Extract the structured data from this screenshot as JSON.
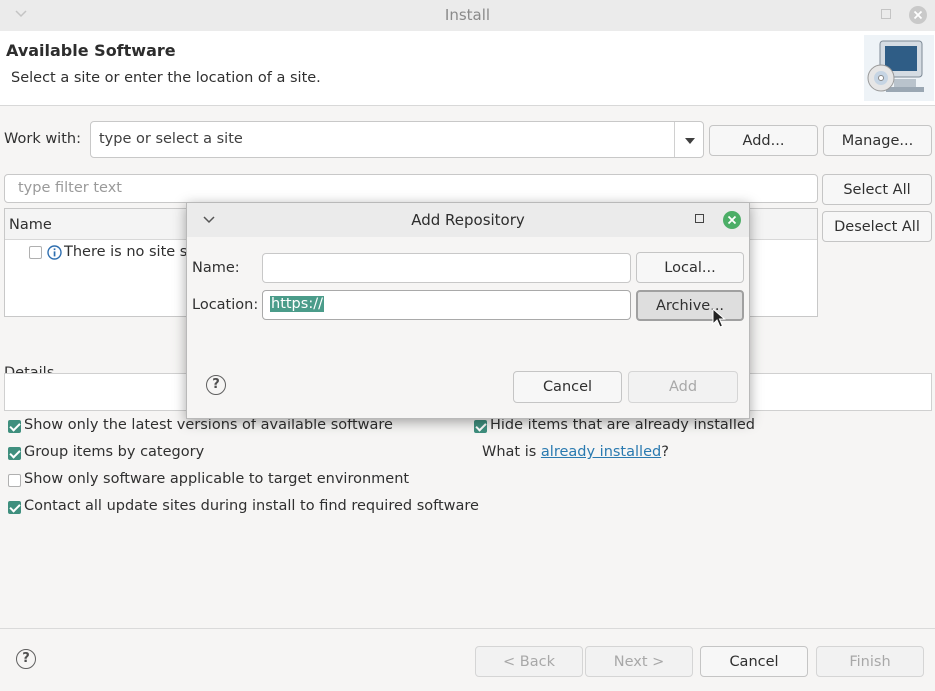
{
  "window": {
    "title": "Install"
  },
  "header": {
    "title": "Available Software",
    "subtitle": "Select a site or enter the location of a site."
  },
  "work_with": {
    "label": "Work with:",
    "placeholder": "type or select a site",
    "add_label": "Add...",
    "manage_label": "Manage..."
  },
  "filter": {
    "placeholder": "type filter text"
  },
  "side_buttons": {
    "select_all": "Select All",
    "deselect_all": "Deselect All"
  },
  "table": {
    "column_name": "Name",
    "row_text": "There is no site se"
  },
  "details": {
    "label": "Details"
  },
  "options": {
    "latest_versions": "Show only the latest versions of available software",
    "group_by_category": "Group items by category",
    "target_env": "Show only software applicable to target environment",
    "contact_sites": "Contact all update sites during install to find required software",
    "hide_installed": "Hide items that are already installed",
    "what_is_prefix": "What is ",
    "already_installed_link": "already installed",
    "what_is_suffix": "?"
  },
  "option_states": {
    "latest_versions": true,
    "group_by_category": true,
    "target_env": false,
    "contact_sites": true,
    "hide_installed": true
  },
  "footer": {
    "back": "< Back",
    "next": "Next >",
    "cancel": "Cancel",
    "finish": "Finish"
  },
  "dialog": {
    "title": "Add Repository",
    "name_label": "Name:",
    "name_value": "",
    "location_label": "Location:",
    "location_value": "https://",
    "local_button": "Local...",
    "archive_button": "Archive...",
    "cancel_button": "Cancel",
    "add_button": "Add"
  },
  "colors": {
    "accent": "#3f8f7e",
    "link": "#2a7ab0",
    "selection": "#4b9c8a"
  },
  "icons": [
    "chevron-down-icon",
    "maximize-icon",
    "close-icon",
    "info-icon",
    "help-icon",
    "install-banner-icon",
    "mouse-cursor-icon"
  ]
}
